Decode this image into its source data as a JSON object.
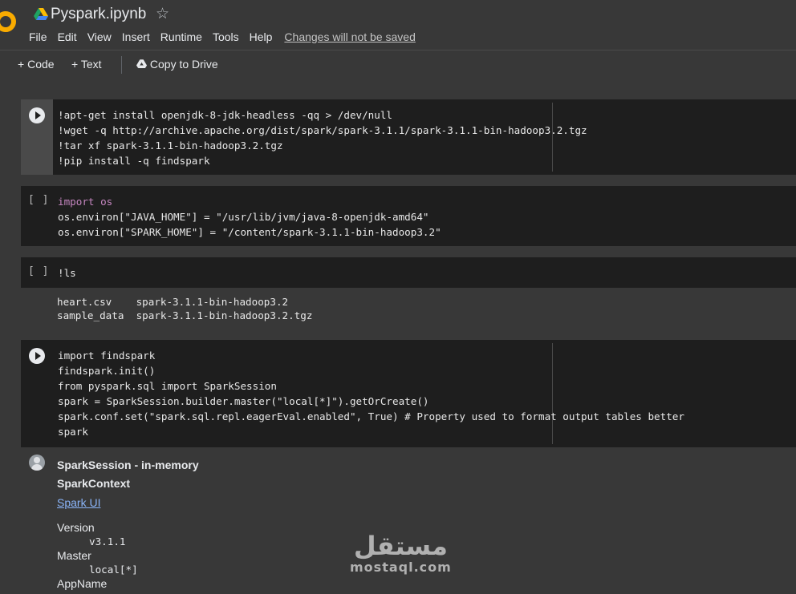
{
  "header": {
    "title": "Pyspark.ipynb",
    "menu": [
      "File",
      "Edit",
      "View",
      "Insert",
      "Runtime",
      "Tools",
      "Help"
    ],
    "unsaved_notice": "Changes will not be saved"
  },
  "toolbar": {
    "add_code": "Code",
    "add_text": "Text",
    "copy_to_drive": "Copy to Drive"
  },
  "cells": {
    "c1": {
      "lines": [
        "!apt-get install openjdk-8-jdk-headless -qq > /dev/null",
        "!wget -q http://archive.apache.org/dist/spark/spark-3.1.1/spark-3.1.1-bin-hadoop3.2.tgz",
        "!tar xf spark-3.1.1-bin-hadoop3.2.tgz",
        "!pip install -q findspark"
      ]
    },
    "c2": {
      "status": "[ ]",
      "lines": [
        "import os",
        "os.environ[\"JAVA_HOME\"] = \"/usr/lib/jvm/java-8-openjdk-amd64\"",
        "os.environ[\"SPARK_HOME\"] = \"/content/spark-3.1.1-bin-hadoop3.2\""
      ]
    },
    "c3": {
      "status": "[ ]",
      "lines": [
        "!ls"
      ],
      "output": [
        "heart.csv    spark-3.1.1-bin-hadoop3.2",
        "sample_data  spark-3.1.1-bin-hadoop3.2.tgz"
      ]
    },
    "c4": {
      "lines": [
        "import findspark",
        "findspark.init()",
        "from pyspark.sql import SparkSession",
        "spark = SparkSession.builder.master(\"local[*]\").getOrCreate()",
        "spark.conf.set(\"spark.sql.repl.eagerEval.enabled\", True) # Property used to format output tables better",
        "spark"
      ]
    }
  },
  "spark_output": {
    "session": "SparkSession - in-memory",
    "context": "SparkContext",
    "ui_link": "Spark UI",
    "version_label": "Version",
    "version_value": "v3.1.1",
    "master_label": "Master",
    "master_value": "local[*]",
    "appname_label": "AppName"
  },
  "watermark": {
    "arabic": "مستقل",
    "latin": "mostaql.com"
  }
}
